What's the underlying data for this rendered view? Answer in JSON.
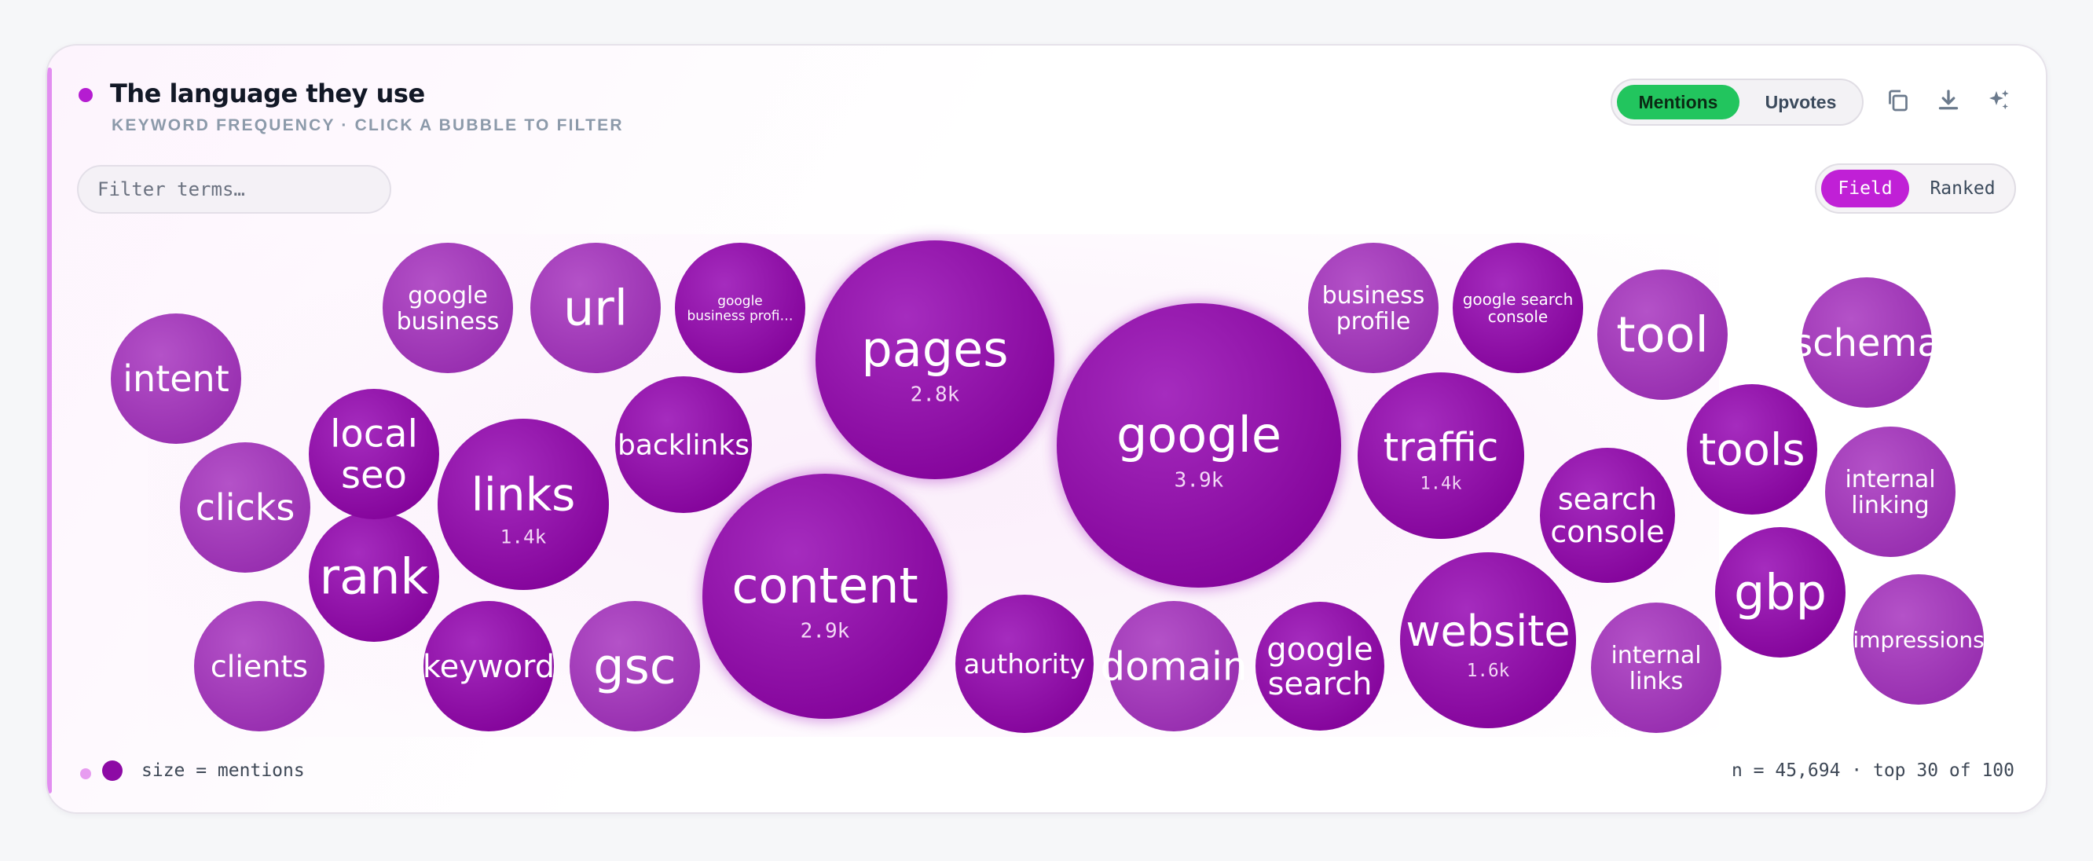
{
  "panel": {
    "title": "The language they use",
    "subtitle": "KEYWORD FREQUENCY · CLICK A BUBBLE TO FILTER",
    "accent_color": "#b51cd1"
  },
  "metric_toggle": {
    "options": [
      "Mentions",
      "Upvotes"
    ],
    "selected": "Mentions",
    "selected_color": "#22c55e"
  },
  "toolbar_icons": [
    "copy-icon",
    "download-icon",
    "sparkle-icon"
  ],
  "filter": {
    "placeholder": "Filter terms…",
    "value": ""
  },
  "view_toggle": {
    "options": [
      "Field",
      "Ranked"
    ],
    "selected": "Field",
    "selected_color": "#c020d6"
  },
  "chart_data": {
    "type": "bubble",
    "size_metric": "mentions",
    "bubbles": [
      {
        "term": "google",
        "count_label": "3.9k",
        "tier": "dark"
      },
      {
        "term": "content",
        "count_label": "2.9k",
        "tier": "dark"
      },
      {
        "term": "pages",
        "count_label": "2.8k",
        "tier": "dark"
      },
      {
        "term": "website",
        "count_label": "1.6k",
        "tier": "dark"
      },
      {
        "term": "links",
        "count_label": "1.4k",
        "tier": "dark"
      },
      {
        "term": "traffic",
        "count_label": "1.4k",
        "tier": "dark"
      },
      {
        "term": "authority",
        "tier": "dark"
      },
      {
        "term": "domain",
        "tier": "light"
      },
      {
        "term": "google search",
        "tier": "dark"
      },
      {
        "term": "search console",
        "tier": "dark"
      },
      {
        "term": "backlinks",
        "tier": "dark"
      },
      {
        "term": "keyword",
        "tier": "dark"
      },
      {
        "term": "gsc",
        "tier": "light"
      },
      {
        "term": "rank",
        "tier": "dark"
      },
      {
        "term": "local seo",
        "tier": "dark"
      },
      {
        "term": "gbp",
        "tier": "dark"
      },
      {
        "term": "tools",
        "tier": "dark"
      },
      {
        "term": "tool",
        "tier": "light"
      },
      {
        "term": "url",
        "tier": "light"
      },
      {
        "term": "google business",
        "tier": "light"
      },
      {
        "term": "google business profi…",
        "tier": "dark"
      },
      {
        "term": "business profile",
        "tier": "light"
      },
      {
        "term": "google search console",
        "tier": "dark"
      },
      {
        "term": "intent",
        "tier": "light"
      },
      {
        "term": "clicks",
        "tier": "light"
      },
      {
        "term": "clients",
        "tier": "light"
      },
      {
        "term": "internal links",
        "tier": "light"
      },
      {
        "term": "internal linking",
        "tier": "light"
      },
      {
        "term": "schema",
        "tier": "light"
      },
      {
        "term": "impressions",
        "tier": "light"
      }
    ],
    "colors": {
      "dark": "#8d0aa5",
      "light": "#a436bb"
    }
  },
  "legend": {
    "label": "size = mentions"
  },
  "footer": {
    "stats": "n = 45,694 · top 30 of 100"
  }
}
